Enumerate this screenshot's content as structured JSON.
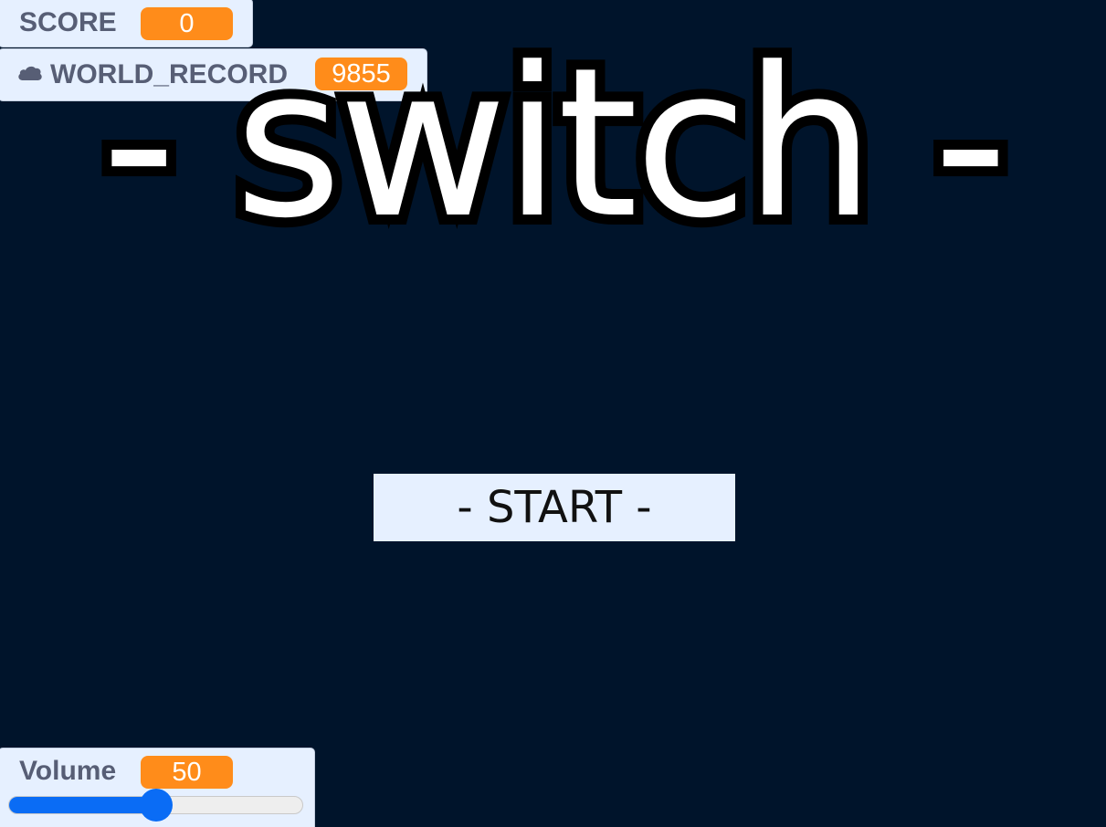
{
  "monitors": {
    "score": {
      "label": "SCORE",
      "value": "0"
    },
    "world_record": {
      "label": "WORLD_RECORD",
      "value": "9855",
      "icon": "cloud-icon"
    },
    "volume": {
      "label": "Volume",
      "value": "50",
      "slider_fraction": 0.5
    }
  },
  "title": "- switch -",
  "start_button": {
    "label": "- START -"
  },
  "colors": {
    "background": "#00142b",
    "monitor_bg": "#e6f0ff",
    "monitor_label": "#575e75",
    "value_badge": "#ff8c1a",
    "slider_accent": "#0a6cf5",
    "title_fill": "#ffffff",
    "title_stroke": "#000000"
  }
}
